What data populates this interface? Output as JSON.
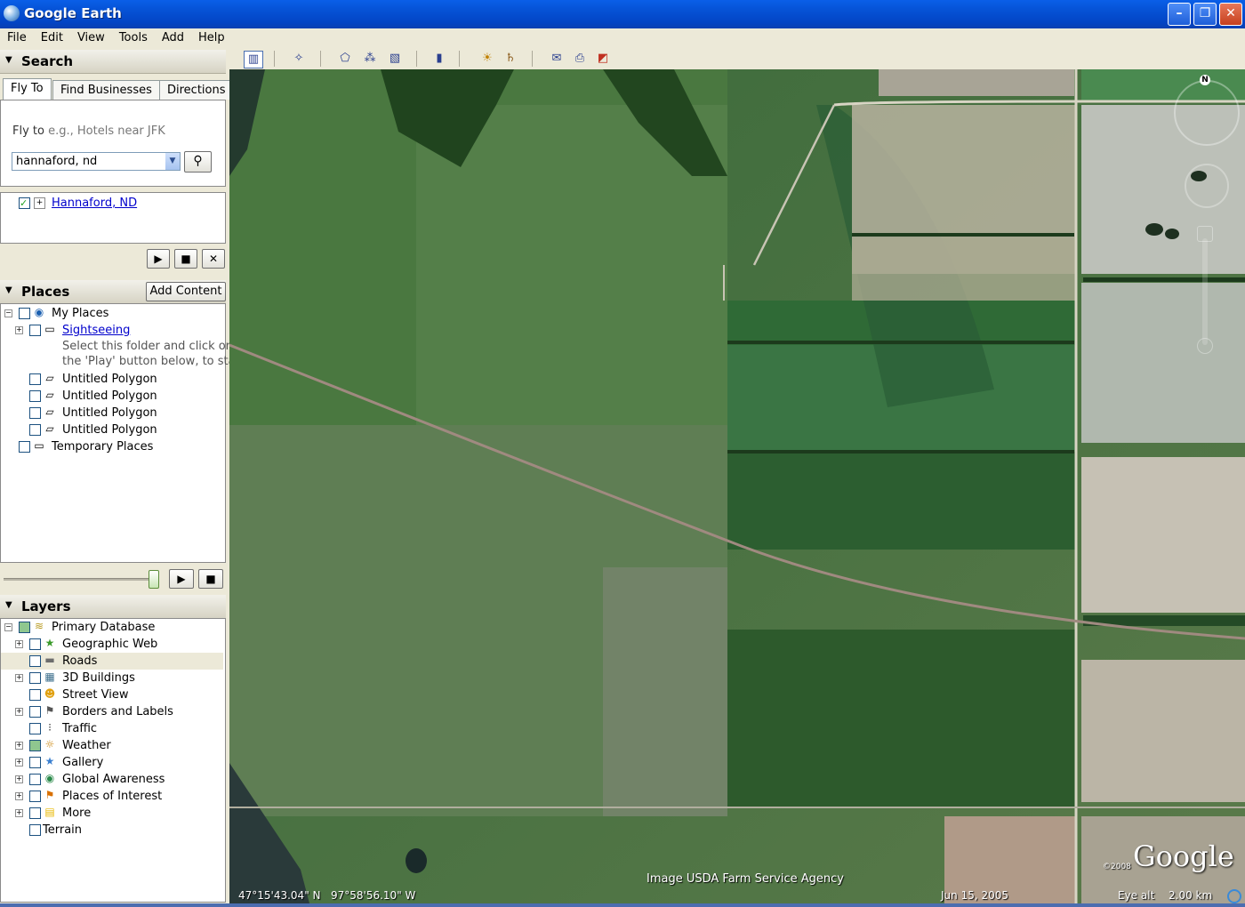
{
  "window": {
    "title": "Google Earth"
  },
  "menu": [
    "File",
    "Edit",
    "View",
    "Tools",
    "Add",
    "Help"
  ],
  "search": {
    "header": "Search",
    "tabs": [
      "Fly To",
      "Find Businesses",
      "Directions"
    ],
    "fly_to_label": "Fly to",
    "fly_to_hint": "e.g., Hotels near JFK",
    "input_value": "hannaford, nd",
    "result": "Hannaford, ND"
  },
  "places": {
    "header": "Places",
    "add_content": "Add Content",
    "items": [
      {
        "label": "My Places"
      },
      {
        "label": "Sightseeing",
        "desc_line1": "Select this folder and click on",
        "desc_line2": "the 'Play' button below, to start"
      },
      {
        "label": "Untitled Polygon"
      },
      {
        "label": "Untitled Polygon"
      },
      {
        "label": "Untitled Polygon"
      },
      {
        "label": "Untitled Polygon"
      },
      {
        "label": "Temporary Places"
      }
    ]
  },
  "layers": {
    "header": "Layers",
    "items": [
      {
        "label": "Primary Database",
        "icon": "layers-icon"
      },
      {
        "label": "Geographic Web",
        "icon": "star-icon"
      },
      {
        "label": "Roads",
        "icon": "road-icon"
      },
      {
        "label": "3D Buildings",
        "icon": "building-icon"
      },
      {
        "label": "Street View",
        "icon": "person-icon"
      },
      {
        "label": "Borders and Labels",
        "icon": "flag-icon"
      },
      {
        "label": "Traffic",
        "icon": "traffic-light-icon"
      },
      {
        "label": "Weather",
        "icon": "sun-icon"
      },
      {
        "label": "Gallery",
        "icon": "star-icon"
      },
      {
        "label": "Global Awareness",
        "icon": "globe-icon"
      },
      {
        "label": "Places of Interest",
        "icon": "flag-icon"
      },
      {
        "label": "More",
        "icon": "note-icon"
      },
      {
        "label": "Terrain",
        "icon": ""
      }
    ]
  },
  "map": {
    "attribution": "Image USDA Farm Service Agency",
    "coords_lat": "47°15'43.04\" N",
    "coords_lon": "97°58'56.10\" W",
    "date": "Jun 15, 2005",
    "eye_alt_label": "Eye alt",
    "eye_alt_value": "2.00 km",
    "logo": "Google",
    "copyright": "©2008",
    "compass_n": "N"
  }
}
